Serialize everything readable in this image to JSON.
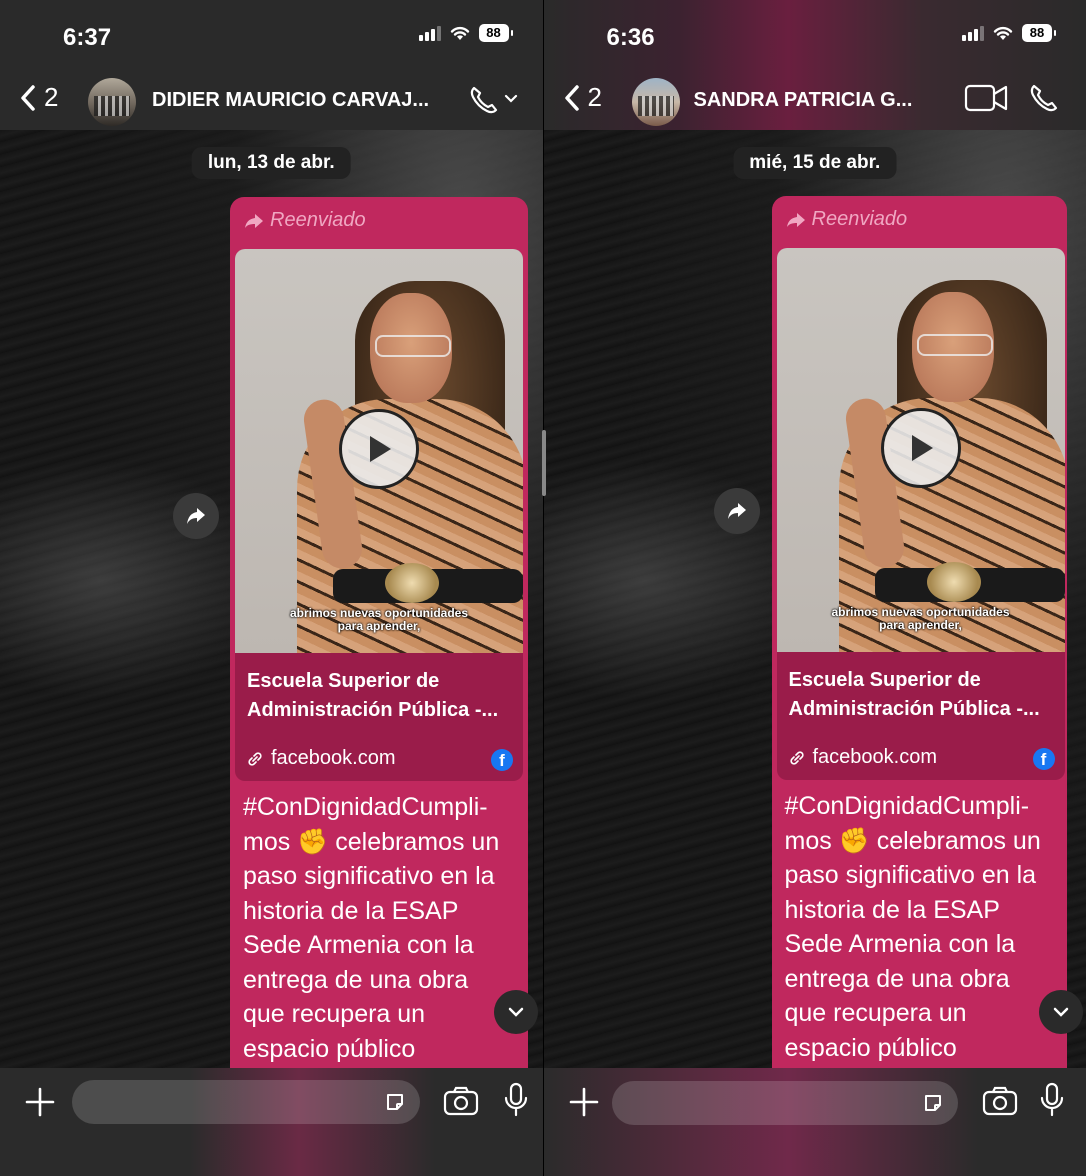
{
  "left": {
    "status": {
      "time": "6:37",
      "battery": "88"
    },
    "header": {
      "back_count": "2",
      "contact": "DIDIER MAURICIO CARVAJ..."
    },
    "date": "lun, 13 de abr.",
    "message": {
      "forward_label": "Reenviado",
      "video_caption": "abrimos nuevas oportunidades\npara aprender,",
      "link_title": "Escuela Superior de Administración Pública -...",
      "link_domain": "facebook.com",
      "text": "#ConDignidadCumpli-\nmos ✊ celebramos un\npaso significativo en la\nhistoria de la ESAP\nSede Armenia con la\nentrega de una obra\nque recupera un\nespacio público"
    }
  },
  "right": {
    "status": {
      "time": "6:36",
      "battery": "88"
    },
    "header": {
      "back_count": "2",
      "contact": "SANDRA PATRICIA G..."
    },
    "date": "mié, 15 de abr.",
    "message": {
      "forward_label": "Reenviado",
      "video_caption": "abrimos nuevas oportunidades\npara aprender,",
      "link_title": "Escuela Superior de Administración Pública -...",
      "link_domain": "facebook.com",
      "text": "#ConDignidadCumpli-\nmos ✊ celebramos un\npaso significativo en la\nhistoria de la ESAP\nSede Armenia con la\nentrega de una obra\nque recupera un\nespacio público"
    }
  },
  "icons": {
    "back": "chevron-left-icon",
    "call": "phone-icon",
    "video_call": "video-camera-icon",
    "forward": "share-arrow-icon",
    "play": "play-icon",
    "link": "link-icon",
    "facebook": "facebook-icon",
    "scroll_down": "chevron-down-icon",
    "attach": "plus-icon",
    "sticker": "sticker-icon",
    "camera": "camera-icon",
    "mic": "microphone-icon"
  },
  "colors": {
    "bubble": "#c0285e",
    "link_card": "#9a1c4a",
    "forward_label": "#f0a7c2",
    "facebook": "#1877f2"
  }
}
